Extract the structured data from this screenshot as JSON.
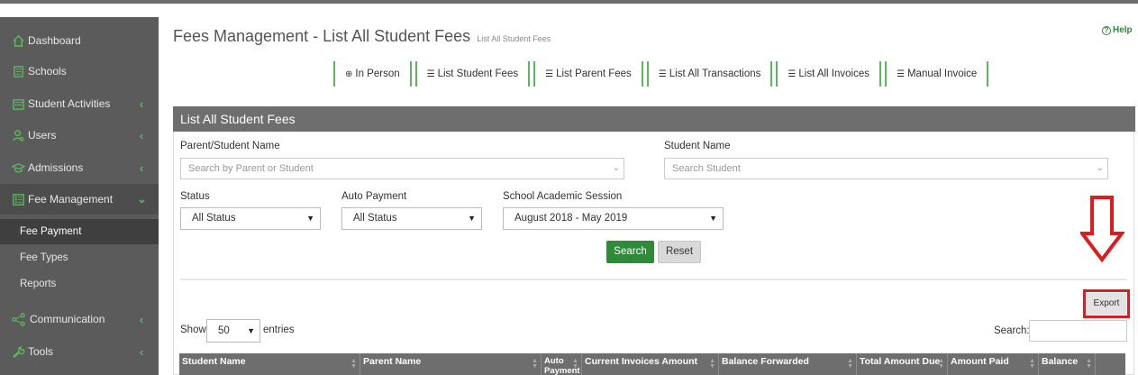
{
  "sidebar": {
    "items": [
      {
        "label": "Dashboard",
        "icon": "home-icon",
        "has_children": false
      },
      {
        "label": "Schools",
        "icon": "building-icon",
        "has_children": false
      },
      {
        "label": "Student Activities",
        "icon": "calendar-icon",
        "has_children": true
      },
      {
        "label": "Users",
        "icon": "users-icon",
        "has_children": true
      },
      {
        "label": "Admissions",
        "icon": "graduation-cap-icon",
        "has_children": true
      },
      {
        "label": "Fee Management",
        "icon": "list-icon",
        "has_children": true
      },
      {
        "label": "Communication",
        "icon": "share-icon",
        "has_children": true
      },
      {
        "label": "Tools",
        "icon": "wrench-icon",
        "has_children": true
      }
    ],
    "submenu": [
      {
        "label": "Fee Payment",
        "active": true
      },
      {
        "label": "Fee Types",
        "active": false
      },
      {
        "label": "Reports",
        "active": false
      }
    ],
    "chevron": "‹"
  },
  "header": {
    "title": "Fees Management - List All Student Fees",
    "subtitle": "List All Student Fees",
    "help_label": "Help"
  },
  "tabs": [
    {
      "label": "In Person",
      "icon": "plus-circle-icon"
    },
    {
      "label": "List Student Fees",
      "icon": "list-icon"
    },
    {
      "label": "List Parent Fees",
      "icon": "list-icon"
    },
    {
      "label": "List All Transactions",
      "icon": "list-icon"
    },
    {
      "label": "List All Invoices",
      "icon": "list-icon"
    },
    {
      "label": "Manual Invoice",
      "icon": "list-icon"
    }
  ],
  "panel": {
    "title": "List All Student Fees",
    "filters": {
      "parent_student_label": "Parent/Student Name",
      "parent_student_placeholder": "Search by Parent or Student",
      "student_name_label": "Student Name",
      "student_name_placeholder": "Search Student",
      "status_label": "Status",
      "status_value": "All Status",
      "auto_payment_label": "Auto Payment",
      "auto_payment_value": "All Status",
      "session_label": "School Academic Session",
      "session_value": "August 2018 - May 2019"
    },
    "search_button": "Search",
    "reset_button": "Reset",
    "export_button": "Export",
    "show_label": "Show",
    "entries_value": "50",
    "entries_label": "entries",
    "table_search_label": "Search:"
  },
  "table": {
    "columns": [
      "Student Name",
      "Parent Name",
      "Auto Payment",
      "Current Invoices Amount",
      "Balance Forwarded",
      "Total Amount Due",
      "Amount Paid",
      "Balance",
      ""
    ]
  },
  "colors": {
    "sidebar_bg": "#5b5b5b",
    "accent_green": "#2e8b3a",
    "tab_border": "#5cb85c",
    "panel_header": "#6e6e6e",
    "annotation_red": "#e01b1b"
  }
}
